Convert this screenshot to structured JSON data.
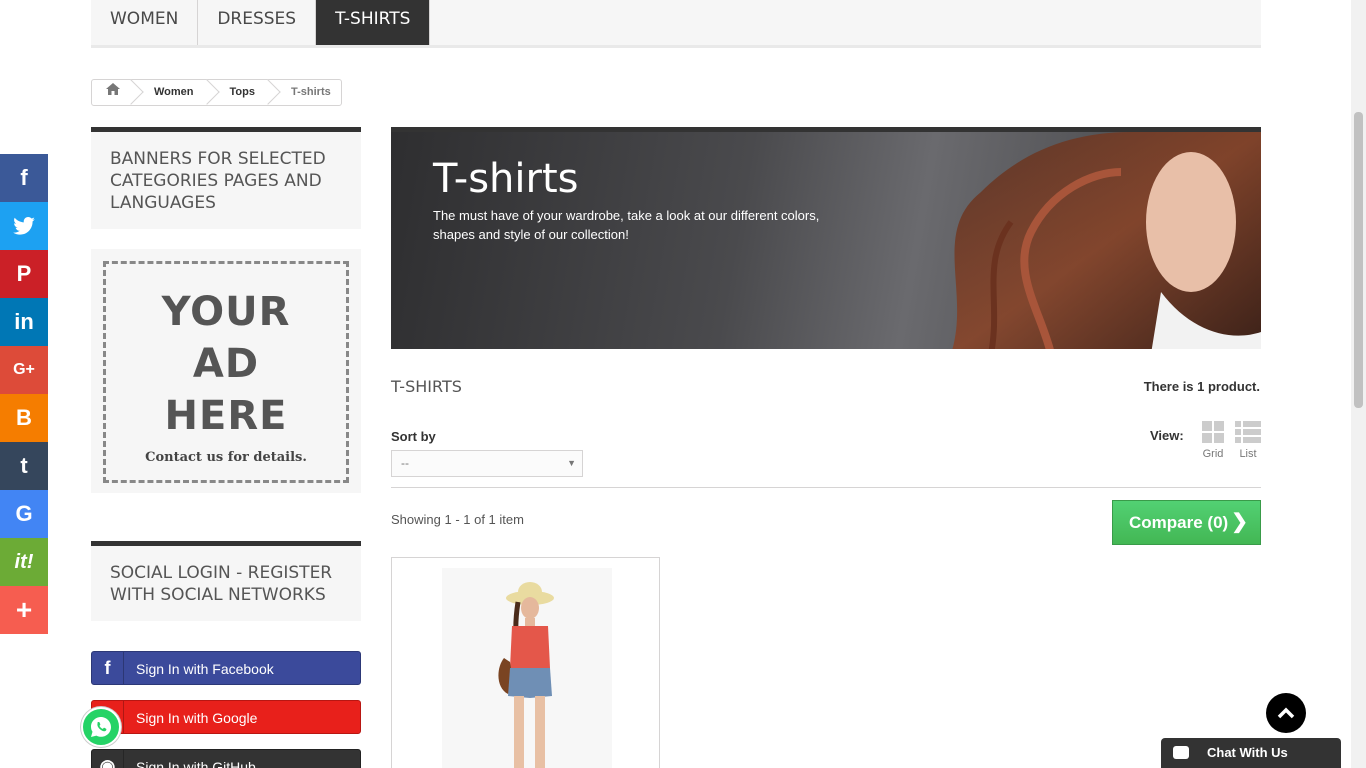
{
  "topmenu": {
    "tabs": [
      {
        "label": "WOMEN"
      },
      {
        "label": "DRESSES"
      },
      {
        "label": "T-SHIRTS"
      }
    ]
  },
  "breadcrumb": {
    "items": [
      "Women",
      "Tops",
      "T-shirts"
    ]
  },
  "left": {
    "banner_block_title": "BANNERS FOR SELECTED CATEGORIES PAGES AND LANGUAGES",
    "ad": {
      "line1": "YOUR",
      "line2": "AD",
      "line3": "HERE",
      "contact": "Contact us for details."
    },
    "social_title": "SOCIAL LOGIN - REGISTER WITH SOCIAL NETWORKS",
    "buttons": [
      {
        "label": "Sign In with Facebook",
        "icon": "facebook-icon",
        "color": "#3b4a9b"
      },
      {
        "label": "Sign In with Google",
        "icon": "google-icon",
        "color": "#e8201b"
      },
      {
        "label": "Sign In with GitHub",
        "icon": "github-icon",
        "color": "#333333"
      }
    ]
  },
  "sharebar": [
    {
      "icon": "facebook-icon",
      "glyph": "f",
      "color": "#3b5998"
    },
    {
      "icon": "twitter-icon",
      "glyph": "t",
      "color": "#1da1f2"
    },
    {
      "icon": "pinterest-icon",
      "glyph": "P",
      "color": "#cb2027"
    },
    {
      "icon": "linkedin-icon",
      "glyph": "in",
      "color": "#0077b5"
    },
    {
      "icon": "googleplus-icon",
      "glyph": "G+",
      "color": "#dd4b39"
    },
    {
      "icon": "blogger-icon",
      "glyph": "B",
      "color": "#f57d00"
    },
    {
      "icon": "tumblr-icon",
      "glyph": "t",
      "color": "#35465c"
    },
    {
      "icon": "google-icon",
      "glyph": "G",
      "color": "#4285f4"
    },
    {
      "icon": "scoopit-icon",
      "glyph": "it!",
      "color": "#6cab36"
    },
    {
      "icon": "more-icon",
      "glyph": "+",
      "color": "#f65d50"
    }
  ],
  "category": {
    "title": "T-shirts",
    "description": "The must have of your wardrobe, take a look at our different colors, shapes and style of our collection!"
  },
  "products": {
    "heading": "T-SHIRTS",
    "count_text": "There is 1 product.",
    "sort_label": "Sort by",
    "sort_value": "--",
    "view_label": "View:",
    "view_grid": "Grid",
    "view_list": "List",
    "showing": "Showing 1 - 1 of 1 item",
    "compare": "Compare (0)"
  },
  "chat": {
    "label": "Chat With Us"
  }
}
